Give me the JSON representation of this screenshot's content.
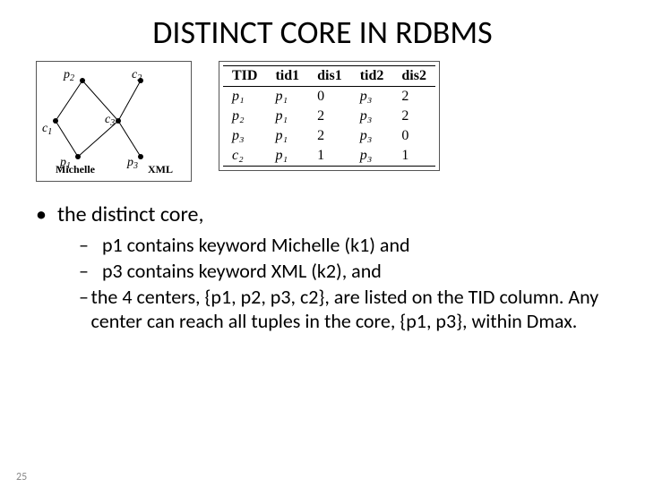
{
  "title": "DISTINCT CORE IN RDBMS",
  "graph": {
    "nodes": {
      "p2": "p",
      "p2s": "2",
      "c2": "c",
      "c2s": "2",
      "c1": "c",
      "c1s": "1",
      "c3": "c",
      "c3s": "3",
      "p1": "p",
      "p1s": "1",
      "p3": "p",
      "p3s": "3"
    },
    "labels": {
      "michelle": "Michelle",
      "xml": "XML"
    }
  },
  "table": {
    "headers": [
      "TID",
      "tid1",
      "dis1",
      "tid2",
      "dis2"
    ],
    "rows": [
      [
        "p₁",
        "p₁",
        "0",
        "p₃",
        "2"
      ],
      [
        "p₂",
        "p₁",
        "2",
        "p₃",
        "2"
      ],
      [
        "p₃",
        "p₁",
        "2",
        "p₃",
        "0"
      ],
      [
        "c₂",
        "p₁",
        "1",
        "p₃",
        "1"
      ]
    ]
  },
  "bullet": "the distinct core,",
  "subs": [
    " p1 contains keyword Michelle (k1) and",
    "p3 contains keyword XML (k2), and",
    " the 4 centers, {p1, p2, p3, c2}, are listed on the TID column. Any center can reach all tuples in the core, {p1, p3}, within Dmax."
  ],
  "pageNumber": "25"
}
